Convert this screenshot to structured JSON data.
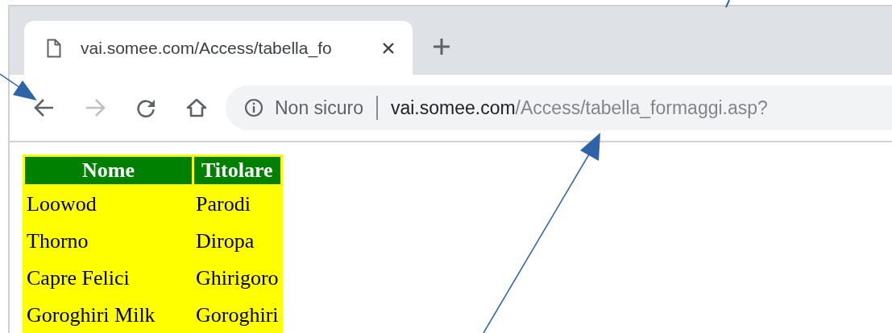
{
  "tab": {
    "title": "vai.somee.com/Access/tabella_fo",
    "selected": true
  },
  "nav": [
    {
      "kind": "back",
      "disabled": false
    },
    {
      "kind": "forward",
      "disabled": true
    },
    {
      "kind": "reload",
      "disabled": false
    },
    {
      "kind": "home",
      "disabled": false
    }
  ],
  "address": {
    "security": "Non sicuro",
    "host": "vai.somee.com",
    "path": "/Access/tabella_formaggi.asp?"
  },
  "table": {
    "columns": [
      "Nome",
      "Titolare"
    ],
    "rows": [
      [
        "Loowod",
        "Parodi"
      ],
      [
        "Thorno",
        "Diropa"
      ],
      [
        "Capre Felici",
        "Ghirigoro"
      ],
      [
        "Goroghiri Milk",
        "Goroghiri"
      ]
    ]
  }
}
